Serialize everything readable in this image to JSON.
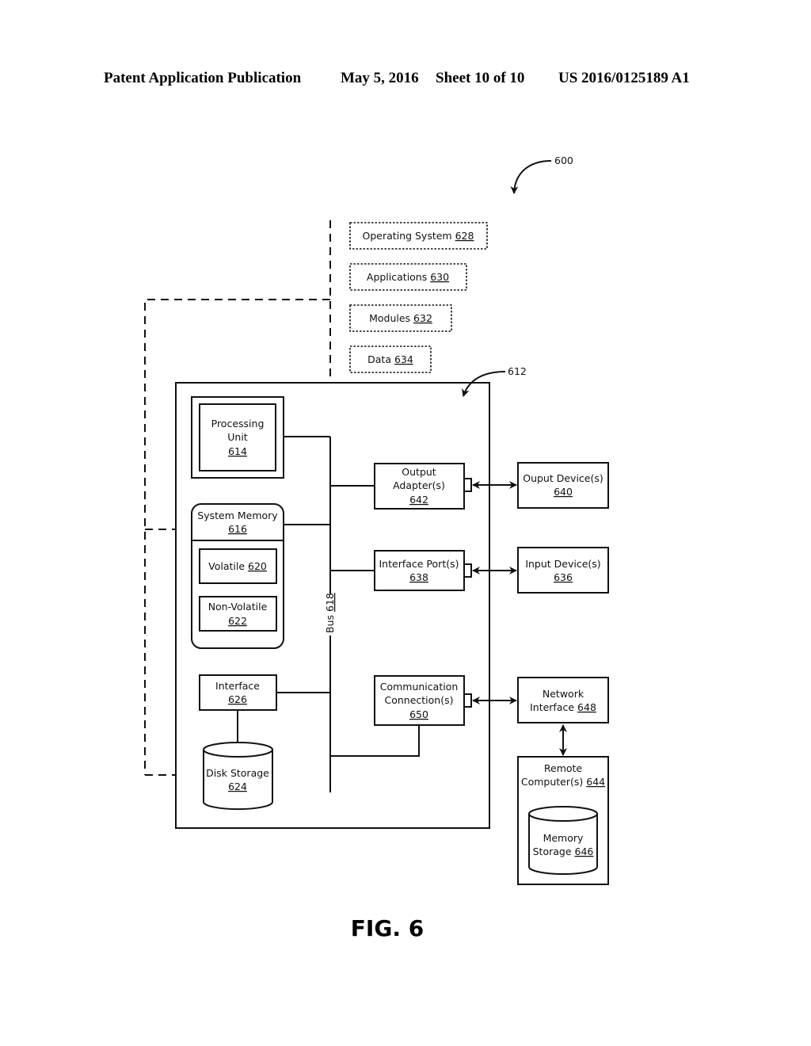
{
  "header": {
    "publication": "Patent Application Publication",
    "date": "May 5, 2016",
    "sheet": "Sheet 10 of 10",
    "number": "US 2016/0125189 A1"
  },
  "figure": {
    "caption": "FIG. 6",
    "ref_main": "600",
    "ref_computer": "612"
  },
  "software": [
    {
      "label": "Operating System",
      "ref": "628"
    },
    {
      "label": "Applications",
      "ref": "630"
    },
    {
      "label": "Modules",
      "ref": "632"
    },
    {
      "label": "Data",
      "ref": "634"
    }
  ],
  "components": {
    "processing_unit": {
      "line1": "Processing",
      "line2": "Unit",
      "ref": "614"
    },
    "system_memory": {
      "label": "System Memory",
      "ref": "616"
    },
    "volatile": {
      "label": "Volatile",
      "ref": "620"
    },
    "non_volatile": {
      "label": "Non-Volatile",
      "ref": "622"
    },
    "interface": {
      "label": "Interface",
      "ref": "626"
    },
    "disk_storage": {
      "label": "Disk Storage",
      "ref": "624"
    },
    "bus": {
      "label": "Bus",
      "ref": "618"
    },
    "output_adapter": {
      "line1": "Output",
      "line2": "Adapter(s)",
      "ref": "642"
    },
    "interface_port": {
      "label": "Interface Port(s)",
      "ref": "638"
    },
    "comm_connection": {
      "line1": "Communication",
      "line2": "Connection(s)",
      "ref": "650"
    },
    "output_device": {
      "label": "Ouput Device(s)",
      "ref": "640"
    },
    "input_device": {
      "label": "Input Device(s)",
      "ref": "636"
    },
    "network_interface": {
      "line1": "Network",
      "line2": "Interface",
      "ref": "648"
    },
    "remote_computer": {
      "line1": "Remote",
      "line2": "Computer(s)",
      "ref": "644"
    },
    "memory_storage": {
      "line1": "Memory",
      "line2": "Storage",
      "ref": "646"
    }
  }
}
